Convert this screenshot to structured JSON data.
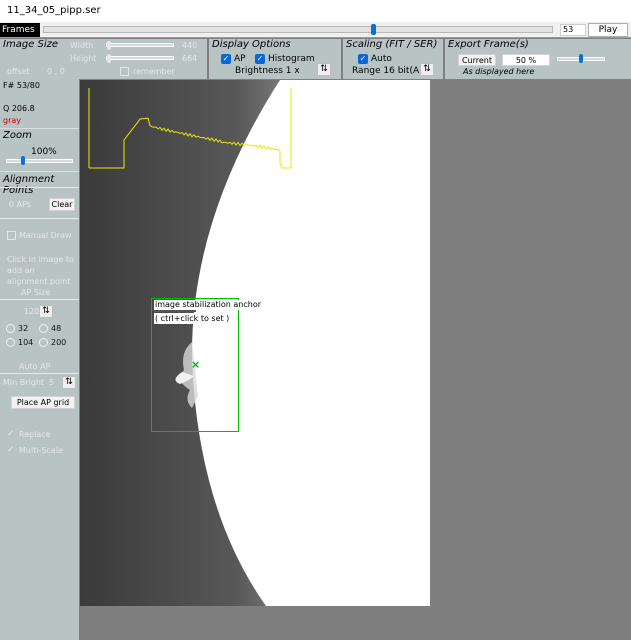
{
  "window": {
    "title": "11_34_05_pipp.ser"
  },
  "frames": {
    "label": "Frames",
    "current": "53",
    "play_label": "Play",
    "position_fraction": 0.65
  },
  "image_size": {
    "title": "Image Size",
    "width_label": "Width",
    "width_value": "440",
    "height_label": "Height",
    "height_value": "664",
    "offset_label": "offset",
    "offset_value": "0 , 0",
    "remember_label": "remember"
  },
  "display_options": {
    "title": "Display Options",
    "ap_label": "AP",
    "ap_checked": true,
    "histogram_label": "Histogram",
    "histogram_checked": true,
    "brightness_label": "Brightness 1 x"
  },
  "scaling": {
    "title": "Scaling (FIT / SER)",
    "auto_label": "Auto",
    "auto_checked": true,
    "range_label": "Range 16 bit(A)"
  },
  "export": {
    "title": "Export Frame(s)",
    "current_label": "Current",
    "percent_value": "50 %",
    "as_displayed_label": "As displayed here"
  },
  "info": {
    "frame_label": "F# 53/80",
    "quality_label": "Q  206.8",
    "color_label": "gray",
    "color_hex": "#cc0000"
  },
  "zoom": {
    "title": "Zoom",
    "value": "100%",
    "fraction": 0.25
  },
  "alignment": {
    "title": "Alignment Points",
    "ap_count": "0 APs",
    "clear_label": "Clear",
    "manual_draw_label": "Manual Draw",
    "hint": "Click in image to add an alignment point",
    "ap_size_label": "AP Size",
    "size_value": "120",
    "size_options": [
      "32",
      "48",
      "104",
      "200"
    ],
    "auto_ap_label": "Auto AP",
    "min_bright_label": "Min Bright",
    "min_bright_value": "5",
    "place_grid_label": "Place AP grid",
    "replace_label": "Replace",
    "multiscale_label": "Multi-Scale"
  },
  "overlay": {
    "anchor_label": "image stabilization anchor",
    "anchor_hint": "( ctrl+click to set )"
  },
  "colors": {
    "accent": "#0a72cf",
    "panel": "#b8c4c4",
    "histogram": "#e8e800",
    "anchor": "#00c000",
    "background": "#7f7f7f"
  },
  "icons": {
    "reset": "reset-arrows-icon",
    "check": "checkmark-icon",
    "anchor_marker": "cross-marker-icon"
  }
}
